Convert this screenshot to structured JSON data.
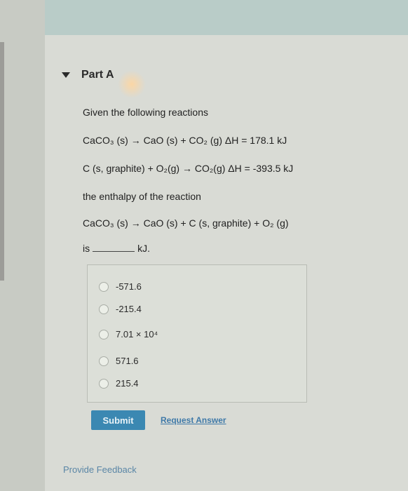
{
  "part": {
    "title": "Part A"
  },
  "question": {
    "intro": "Given the following reactions",
    "reaction1": "CaCO₃ (s) → CaO (s) + CO₂ (g) ΔH = 178.1 kJ",
    "reaction2": "C (s, graphite) + O₂(g) → CO₂(g) ΔH = -393.5 kJ",
    "prompt": "the enthalpy of the reaction",
    "target_reaction": "CaCO₃ (s) → CaO (s) + C (s, graphite) + O₂ (g)",
    "answer_prefix": "is",
    "answer_unit": "kJ."
  },
  "choices": [
    {
      "label": "-571.6"
    },
    {
      "label": "-215.4"
    },
    {
      "label": "7.01 × 10⁴"
    },
    {
      "label": "571.6"
    },
    {
      "label": "215.4"
    }
  ],
  "actions": {
    "submit_label": "Submit",
    "request_answer_label": "Request Answer"
  },
  "footer": {
    "feedback_label": "Provide Feedback"
  }
}
